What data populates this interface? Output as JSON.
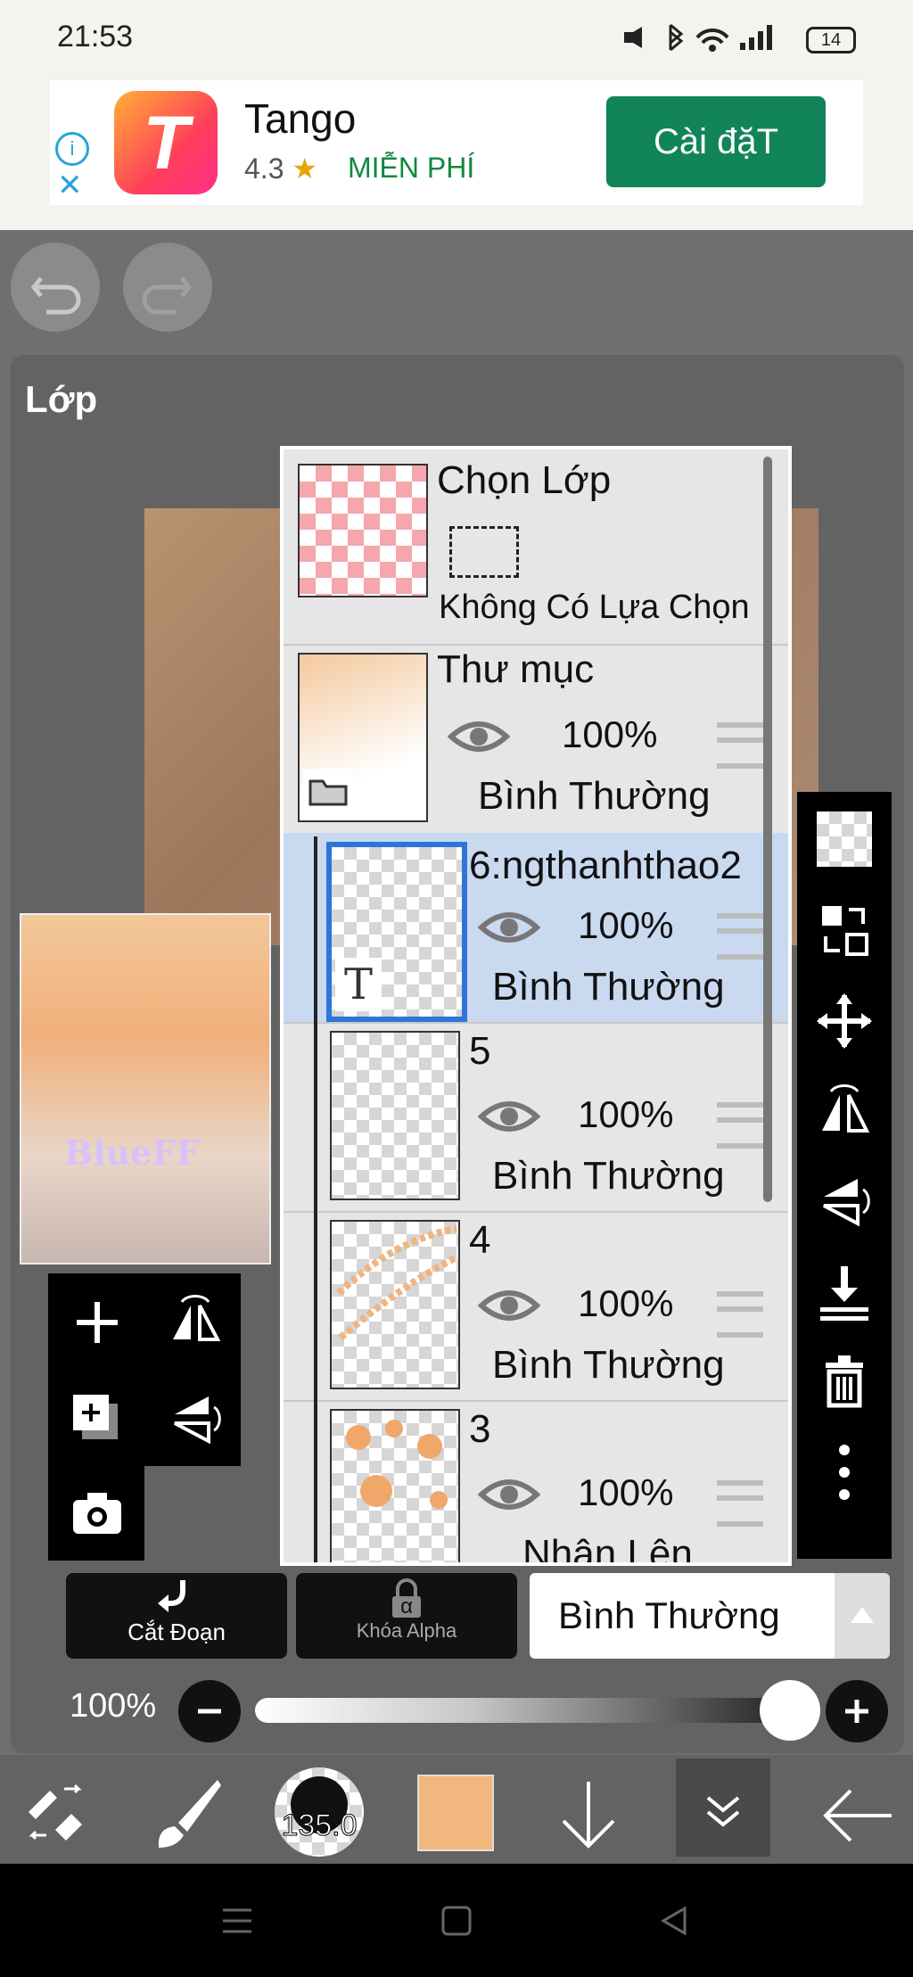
{
  "status_bar": {
    "time": "21:53",
    "battery": "14"
  },
  "ad": {
    "app_name": "Tango",
    "rating": "4.3",
    "star": "★",
    "price": "MIỄN PHÍ",
    "install_label": "Cài đặT",
    "logo_letter": "T",
    "info_icon": "i",
    "close_icon": "✕"
  },
  "panel": {
    "title": "Lớp"
  },
  "canvas_preview_text": "BlueFF",
  "layers": [
    {
      "name": "Chọn Lớp",
      "subtitle": "Không Có Lựa Chọn"
    },
    {
      "name": "Thư mục",
      "opacity": "100%",
      "mode": "Bình Thường"
    },
    {
      "name": "6:ngthanhthao2",
      "opacity": "100%",
      "mode": "Bình Thường",
      "selected": true
    },
    {
      "name": "5",
      "opacity": "100%",
      "mode": "Bình Thường"
    },
    {
      "name": "4",
      "opacity": "100%",
      "mode": "Bình Thường"
    },
    {
      "name": "3",
      "opacity": "100%",
      "mode": "Nhân Lên"
    }
  ],
  "controls": {
    "clip_label": "Cắt Đoạn",
    "alpha_lock_label": "Khóa Alpha",
    "alpha_symbol": "α",
    "blend_mode": "Bình Thường",
    "opacity": "100%"
  },
  "bottom_bar": {
    "brush_size": "135.0",
    "color": "#f1b77e"
  },
  "colors": {
    "accent_blue": "#2f74d9",
    "ad_button": "#12845a",
    "panel": "#636363"
  }
}
